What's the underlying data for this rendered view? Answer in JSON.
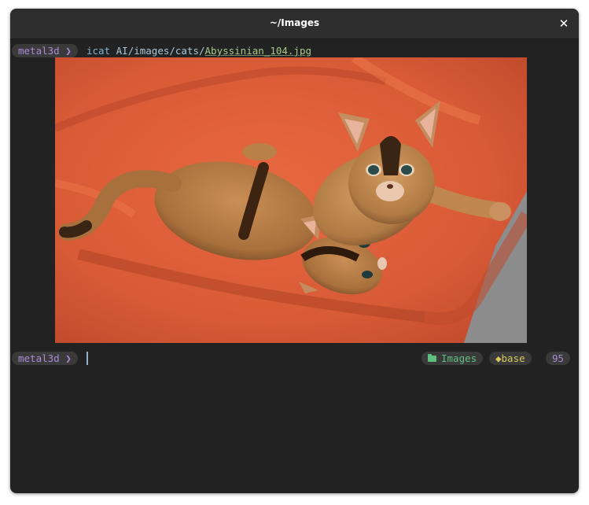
{
  "window": {
    "title": "~/Images",
    "close_glyph": "✕"
  },
  "terminal": {
    "prompt_label": "metal3d ❯",
    "command": {
      "program": "icat",
      "path_prefix": "AI/images/cats/",
      "filename": "Abyssinian_104.jpg"
    },
    "image": {
      "subject": "cat-photo-icon"
    },
    "status": {
      "dir_icon": "folder-icon",
      "dir_label": "Images",
      "env_label": "◆base",
      "number": "95"
    }
  },
  "colors": {
    "terminal_bg": "#222222",
    "titlebar_bg": "#2e2e2e",
    "prompt": "#a98bd8",
    "command": "#7fb2d6",
    "filename": "#a8c98a",
    "dir": "#5fbf7e",
    "env": "#d8c85a"
  }
}
